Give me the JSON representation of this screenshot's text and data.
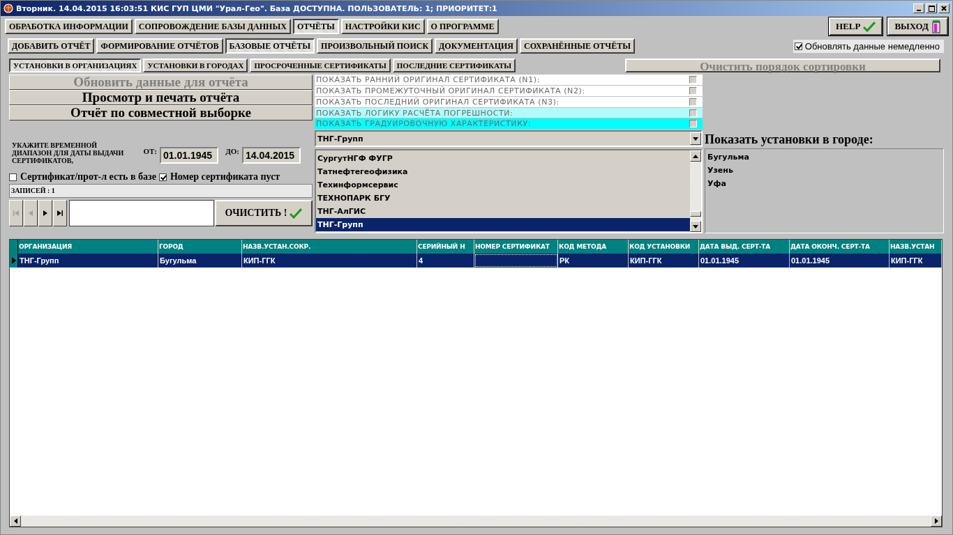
{
  "window": {
    "title": "Вторник. 14.04.2015 16:03:51 КИС ГУП ЦМИ \"Урал-Гео\". База ДОСТУПНА. ПОЛЬЗОВАТЕЛЬ: 1; ПРИОРИТЕТ:1"
  },
  "main_tabs": [
    {
      "label": "ОБРАБОТКА ИНФОРМАЦИИ",
      "selected": false
    },
    {
      "label": "СОПРОВОЖДЕНИЕ БАЗЫ ДАННЫХ",
      "selected": false
    },
    {
      "label": "ОТЧЁТЫ",
      "selected": true
    },
    {
      "label": "НАСТРОЙКИ КИС",
      "selected": false
    },
    {
      "label": "О ПРОГРАММЕ",
      "selected": false
    }
  ],
  "help_button": {
    "label": "HELP"
  },
  "exit_button": {
    "label": "ВЫХОД"
  },
  "report_tabs": [
    {
      "label": "ДОБАВИТЬ ОТЧЁТ",
      "selected": false
    },
    {
      "label": "ФОРМИРОВАНИЕ ОТЧЁТОВ",
      "selected": false
    },
    {
      "label": "БАЗОВЫЕ ОТЧЁТЫ",
      "selected": true
    },
    {
      "label": "ПРОИЗВОЛЬНЫЙ ПОИСК",
      "selected": false
    },
    {
      "label": "ДОКУМЕНТАЦИЯ",
      "selected": false
    },
    {
      "label": "СОХРАНЁННЫЕ ОТЧЁТЫ",
      "selected": false
    }
  ],
  "auto_refresh": {
    "label": "Обновлять данные немедленно",
    "checked": true
  },
  "base_tabs": [
    {
      "label": "УСТАНОВКИ В ОРГАНИЗАЦИЯХ",
      "selected": true
    },
    {
      "label": "УСТАНОВКИ В ГОРОДАХ",
      "selected": false
    },
    {
      "label": "ПРОСРОЧЕННЫЕ СЕРТИФИКАТЫ",
      "selected": false
    },
    {
      "label": "ПОСЛЕДНИЕ СЕРТИФИКАТЫ",
      "selected": false
    }
  ],
  "clear_sort_button": {
    "label": "Очистить порядок сортировки",
    "disabled": true
  },
  "action_buttons": [
    {
      "label": "Обновить данные для отчёта",
      "disabled": true
    },
    {
      "label": "Просмотр и печать отчёта",
      "disabled": false
    },
    {
      "label": "Отчёт по совместной выборке",
      "disabled": false
    }
  ],
  "options": [
    {
      "label": "ПОКАЗАТЬ РАННИЙ ОРИГИНАЛ СЕРТИФИКАТА (N1):",
      "checked": false,
      "color": "#ffffff"
    },
    {
      "label": "ПОКАЗАТЬ ПРОМЕЖУТОЧНЫЙ ОРИГИНАЛ СЕРТИФИКАТА (N2):",
      "checked": false,
      "color": "#ffffff"
    },
    {
      "label": "ПОКАЗАТЬ ПОСЛЕДНИЙ ОРИГИНАЛ СЕРТИФИКАТА (N3):",
      "checked": false,
      "color": "#ffffff"
    },
    {
      "label": "ПОКАЗАТЬ ЛОГИКУ РАСЧЁТА ПОГРЕШНОСТИ:",
      "checked": false,
      "color": "#b3fbfb"
    },
    {
      "label": "ПОКАЗАТЬ ГРАДУИРОВОЧНУЮ ХАРАКТЕРИСТИКУ:",
      "checked": false,
      "color": "#00ffff"
    }
  ],
  "date_range": {
    "label": "УКАЖИТЕ ВРЕМЕННОЙ ДИАПАЗОН ДЛЯ ДАТЫ ВЫДАЧИ СЕРТИФИКАТОВ,",
    "from_label": "ОТ:",
    "from": "01.01.1945",
    "to_label": "ДО:",
    "to": "14.04.2015"
  },
  "filters": [
    {
      "label": "Сертификат/прот-л есть в базе",
      "checked": false
    },
    {
      "label": "Номер сертификата пуст",
      "checked": true
    }
  ],
  "records": "ЗАПИСЕЙ : 1",
  "navigator": [
    {
      "kind": "first",
      "disabled": true
    },
    {
      "kind": "prev",
      "disabled": true
    },
    {
      "kind": "next",
      "disabled": false
    },
    {
      "kind": "last",
      "disabled": false
    }
  ],
  "clear_button": {
    "label": "ОЧИСТИТЬ !"
  },
  "organization_combo": {
    "value": "ТНГ-Групп"
  },
  "organization_list": [
    {
      "label": "СургутНГФ ФУГР",
      "selected": false
    },
    {
      "label": "Татнефтегеофизика",
      "selected": false
    },
    {
      "label": "Техинформсервис",
      "selected": false
    },
    {
      "label": "ТЕХНОПАРК БГУ",
      "selected": false
    },
    {
      "label": "ТНГ-АлГИС",
      "selected": false
    },
    {
      "label": "ТНГ-Групп",
      "selected": true
    }
  ],
  "city_label": "Показать установки в городе:",
  "city_list": [
    {
      "label": "Бугульма"
    },
    {
      "label": "Узень"
    },
    {
      "label": "Уфа"
    }
  ],
  "table": {
    "columns": [
      "ОРГАНИЗАЦИЯ",
      "ГОРОД",
      "НАЗВ.УСТАН.СОКР.",
      "СЕРИЙНЫЙ Н",
      "НОМЕР СЕРТИФИКАТ",
      "КОД МЕТОДА",
      "КОД УСТАНОВКИ",
      "ДАТА ВЫД. СЕРТ-ТА",
      "ДАТА ОКОНЧ. СЕРТ-ТА",
      "НАЗВ.УСТАН"
    ],
    "rows": [
      {
        "selected": true,
        "cells": [
          "ТНГ-Групп",
          "Бугульма",
          "КИП-ГГК",
          "4",
          "",
          "РК",
          "КИП-ГГК",
          "01.01.1945",
          "01.01.1945",
          "КИП-ГГК"
        ]
      }
    ]
  }
}
